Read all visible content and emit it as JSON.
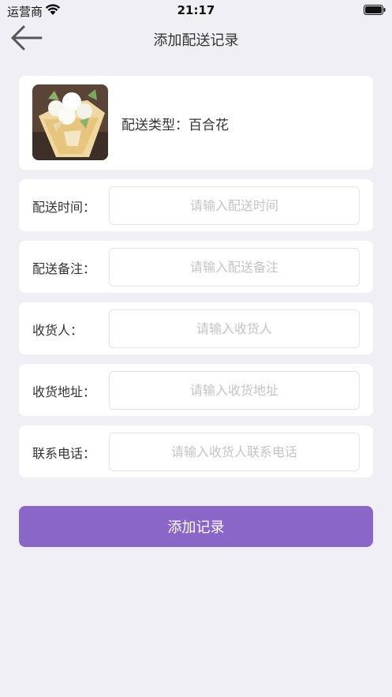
{
  "status_bar": {
    "carrier": "运营商",
    "time": "21:17"
  },
  "nav": {
    "title": "添加配送记录",
    "back_icon": "arrow-left-icon"
  },
  "product": {
    "image_icon": "lily-bouquet-photo",
    "type_text": "配送类型：百合花"
  },
  "form": {
    "rows": [
      {
        "label": "配送时间：",
        "placeholder": "请输入配送时间",
        "value": ""
      },
      {
        "label": "配送备注：",
        "placeholder": "请输入配送备注",
        "value": ""
      },
      {
        "label": "收货人：",
        "placeholder": "请输入收货人",
        "value": ""
      },
      {
        "label": "收货地址：",
        "placeholder": "请输入收货地址",
        "value": ""
      },
      {
        "label": "联系电话：",
        "placeholder": "请输入收货人联系电话",
        "value": ""
      }
    ]
  },
  "submit": {
    "label": "添加记录"
  },
  "colors": {
    "background": "#f0eff5",
    "accent": "#8b66c9",
    "card": "#ffffff"
  }
}
